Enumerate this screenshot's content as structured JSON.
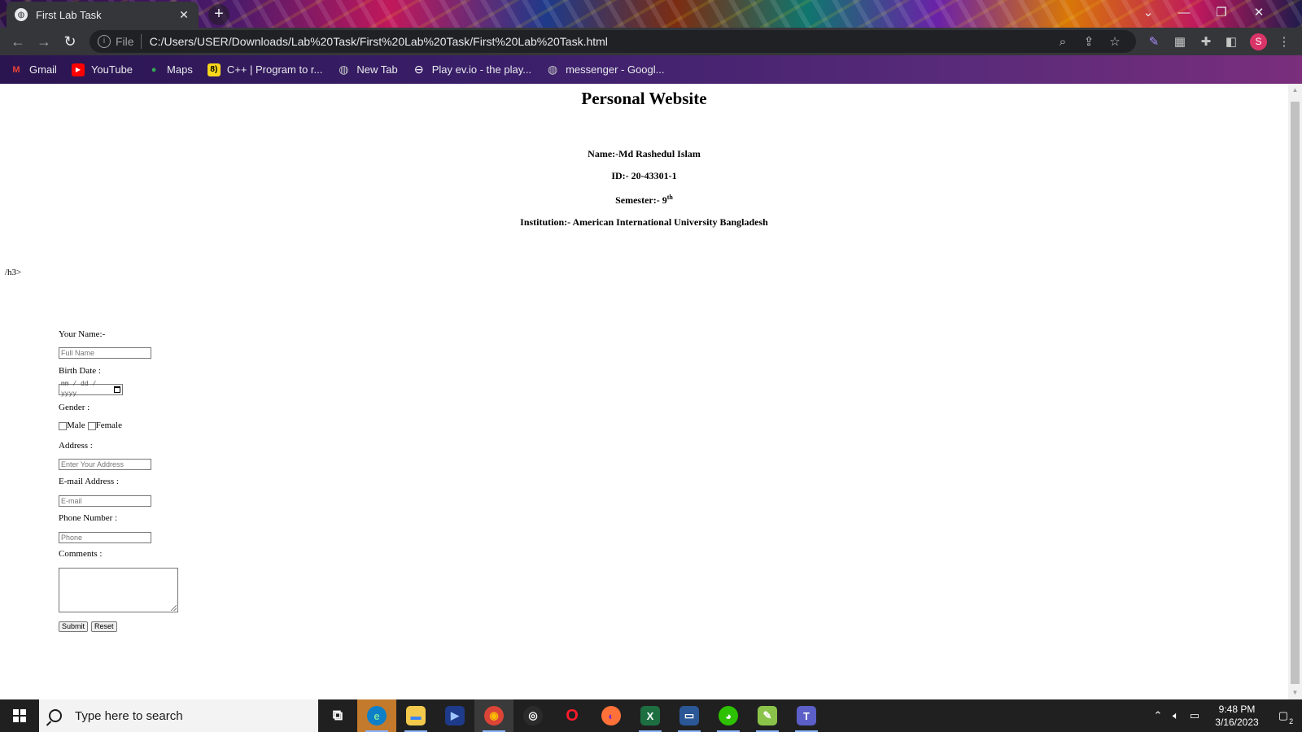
{
  "browser": {
    "tab_title": "First Lab Task",
    "close_tab_glyph": "✕",
    "new_tab_glyph": "+",
    "url_scheme_label": "File",
    "url": "C:/Users/USER/Downloads/Lab%20Task/First%20Lab%20Task/First%20Lab%20Task.html",
    "profile_initial": "S",
    "bookmarks": [
      {
        "label": "Gmail",
        "icon": "gmail-icon",
        "glyph": "M",
        "color": "#ea4335",
        "bg": "transparent"
      },
      {
        "label": "YouTube",
        "icon": "youtube-icon",
        "glyph": "▶",
        "color": "#ffffff",
        "bg": "#ff0000"
      },
      {
        "label": "Maps",
        "icon": "maps-icon",
        "glyph": "●",
        "color": "#34a853",
        "bg": "transparent"
      },
      {
        "label": "C++ | Program to r...",
        "icon": "cpp-site-icon",
        "glyph": "8)",
        "color": "#000000",
        "bg": "#f9d71c"
      },
      {
        "label": "New Tab",
        "icon": "globe-icon",
        "glyph": "◍",
        "color": "#c4c7c5",
        "bg": "transparent"
      },
      {
        "label": "Play ev.io - the play...",
        "icon": "evio-icon",
        "glyph": "⊖",
        "color": "#ffffff",
        "bg": "transparent"
      },
      {
        "label": "messenger - Googl...",
        "icon": "globe-icon",
        "glyph": "◍",
        "color": "#c4c7c5",
        "bg": "transparent"
      }
    ]
  },
  "page": {
    "title": "Personal Website",
    "name_line": "Name:-Md Rashedul Islam",
    "id_line": "ID:- 20-43301-1",
    "semester_prefix": "Semester:- 9",
    "semester_suffix": "th",
    "institution_line": "Institution:- American International University Bangladesh",
    "stray_text": "/h3>"
  },
  "form": {
    "name_label": "Your Name:-",
    "name_placeholder": "Full Name",
    "birth_label": "Birth Date :",
    "date_placeholder": "mm / dd / yyyy",
    "gender_label": "Gender :",
    "male_label": "Male",
    "female_label": "Female",
    "address_label": "Address :",
    "address_placeholder": "Enter Your Address",
    "email_label": "E-mail Address :",
    "email_placeholder": "E-mail",
    "phone_label": "Phone Number :",
    "phone_placeholder": "Phone",
    "comments_label": "Comments :",
    "submit_label": "Submit",
    "reset_label": "Reset"
  },
  "taskbar": {
    "search_placeholder": "Type here to search",
    "time": "9:48 PM",
    "date": "3/16/2023",
    "notification_count": "2",
    "apps": [
      {
        "name": "task-view-icon",
        "glyph": "⧉",
        "bg": "transparent",
        "color": "#ffffff"
      },
      {
        "name": "edge-icon",
        "glyph": "e",
        "bg": "#0f7fc8",
        "color": "#7fe3a0"
      },
      {
        "name": "file-explorer-icon",
        "glyph": "▬",
        "bg": "#f2c94c",
        "color": "#3b82f6"
      },
      {
        "name": "media-player-icon",
        "glyph": "▶",
        "bg": "#1e3a8a",
        "color": "#9ec5ff"
      },
      {
        "name": "chrome-icon",
        "glyph": "◉",
        "bg": "#db4437",
        "color": "#fbbc05"
      },
      {
        "name": "obs-icon",
        "glyph": "◎",
        "bg": "#2b2b2b",
        "color": "#ffffff"
      },
      {
        "name": "opera-icon",
        "glyph": "O",
        "bg": "transparent",
        "color": "#ff1b2d"
      },
      {
        "name": "firefox-icon",
        "glyph": "◐",
        "bg": "#ff7139",
        "color": "#7b2cbf"
      },
      {
        "name": "excel-icon",
        "glyph": "X",
        "bg": "#1d6f42",
        "color": "#ffffff"
      },
      {
        "name": "remote-desktop-icon",
        "glyph": "▭",
        "bg": "#2b5797",
        "color": "#ffffff"
      },
      {
        "name": "wechat-icon",
        "glyph": "◕",
        "bg": "#2dc100",
        "color": "#ffffff"
      },
      {
        "name": "notepad-icon",
        "glyph": "✎",
        "bg": "#8bc34a",
        "color": "#ffffff"
      },
      {
        "name": "teams-icon",
        "glyph": "T",
        "bg": "#5b5fc7",
        "color": "#ffffff"
      }
    ]
  }
}
